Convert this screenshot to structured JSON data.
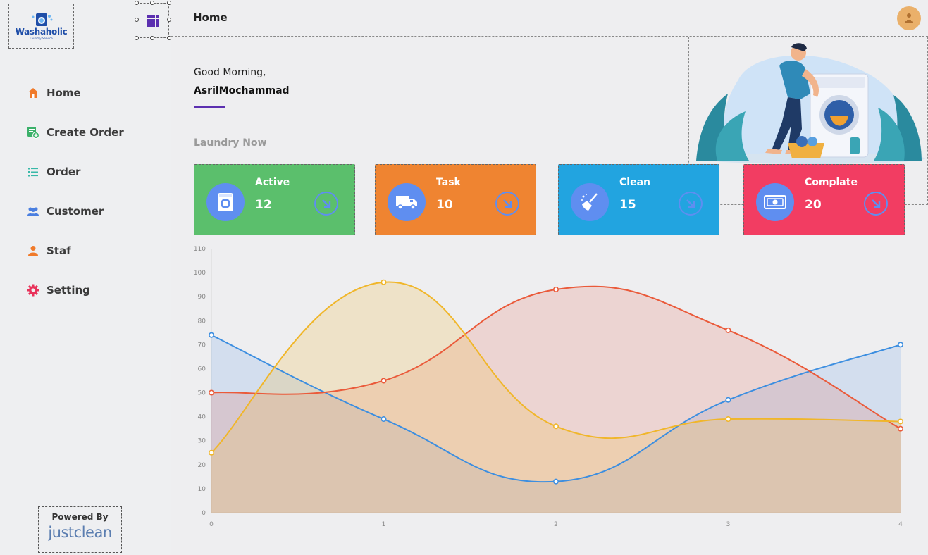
{
  "app": {
    "logo_text": "Washaholic",
    "logo_sub": "Laundry Service",
    "page_title": "Home",
    "grid_icon": "apps-grid-icon",
    "avatar_icon": "user-avatar-icon"
  },
  "sidebar": {
    "items": [
      {
        "label": "Home",
        "icon": "home-icon",
        "color": "#f07a2a"
      },
      {
        "label": "Create Order",
        "icon": "create-order-icon",
        "color": "#3bb06a"
      },
      {
        "label": "Order",
        "icon": "list-icon",
        "color": "#38b8a8"
      },
      {
        "label": "Customer",
        "icon": "customers-icon",
        "color": "#4a7fe0"
      },
      {
        "label": "Staf",
        "icon": "user-icon",
        "color": "#f07a2a"
      },
      {
        "label": "Setting",
        "icon": "gear-icon",
        "color": "#e8325a"
      }
    ],
    "powered_by": "Powered By",
    "powered_brand": "justclean"
  },
  "greeting": {
    "text": "Good Morning,",
    "name": "AsrilMochammad"
  },
  "section_title": "Laundry Now",
  "cards": [
    {
      "label": "Active",
      "value": "12",
      "color": "#5bbf6c",
      "icon": "washing-machine-icon"
    },
    {
      "label": "Task",
      "value": "10",
      "color": "#ef8431",
      "icon": "delivery-truck-icon"
    },
    {
      "label": "Clean",
      "value": "15",
      "color": "#22a4e0",
      "icon": "broom-icon"
    },
    {
      "label": "Complate",
      "value": "20",
      "color": "#f23d62",
      "icon": "money-icon"
    }
  ],
  "chart_data": {
    "type": "area",
    "x": [
      0,
      1,
      2,
      3,
      4
    ],
    "ylim": [
      0,
      110
    ],
    "yticks": [
      0,
      10,
      20,
      30,
      40,
      50,
      60,
      70,
      80,
      90,
      100,
      110
    ],
    "grid": false,
    "series": [
      {
        "color": "#3c8ee0",
        "fill": "rgba(120,170,230,0.22)",
        "values": [
          74,
          39,
          13,
          47,
          70
        ]
      },
      {
        "color": "#ea5a3a",
        "fill": "rgba(232,110,90,0.20)",
        "values": [
          50,
          55,
          93,
          76,
          35
        ]
      },
      {
        "color": "#f0b62a",
        "fill": "rgba(240,190,80,0.25)",
        "values": [
          25,
          96,
          36,
          39,
          38
        ]
      }
    ]
  }
}
